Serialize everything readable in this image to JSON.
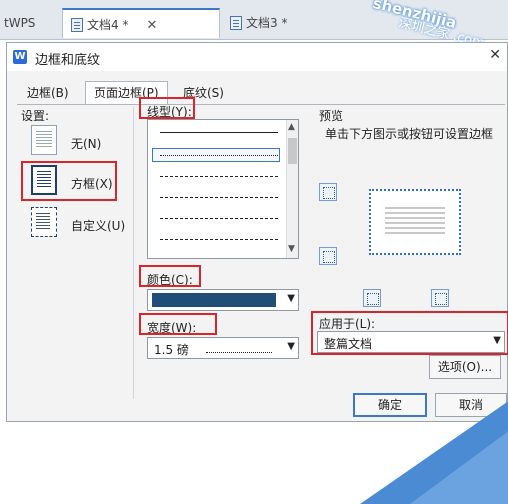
{
  "tabs": [
    {
      "label": "tWPS"
    },
    {
      "label": "文档4 *",
      "close": "✕"
    },
    {
      "label": "文档3 *"
    }
  ],
  "watermark": {
    "line1": "shenzhijia",
    "line2": "深圳之家 .com"
  },
  "dialog": {
    "title": "边框和底纹",
    "close": "✕",
    "tabs": [
      "边框(B)",
      "页面边框(P)",
      "底纹(S)"
    ],
    "settings": {
      "label": "设置:",
      "items": [
        "无(N)",
        "方框(X)",
        "自定义(U)"
      ]
    },
    "line_style": {
      "label": "线型(Y):"
    },
    "color": {
      "label": "颜色(C):",
      "value": "#1f4e79"
    },
    "width": {
      "label": "宽度(W):",
      "value": "1.5 磅"
    },
    "preview": {
      "label": "预览",
      "hint": "单击下方图示或按钮可设置边框"
    },
    "apply_to": {
      "label": "应用于(L):",
      "value": "整篇文档"
    },
    "options_button": "选项(O)...",
    "ok_button": "确定",
    "cancel_button": "取消"
  },
  "colors": {
    "highlight": "#d9252b",
    "accent": "#3d78c8",
    "background_triangle": "#4a8bd4"
  }
}
